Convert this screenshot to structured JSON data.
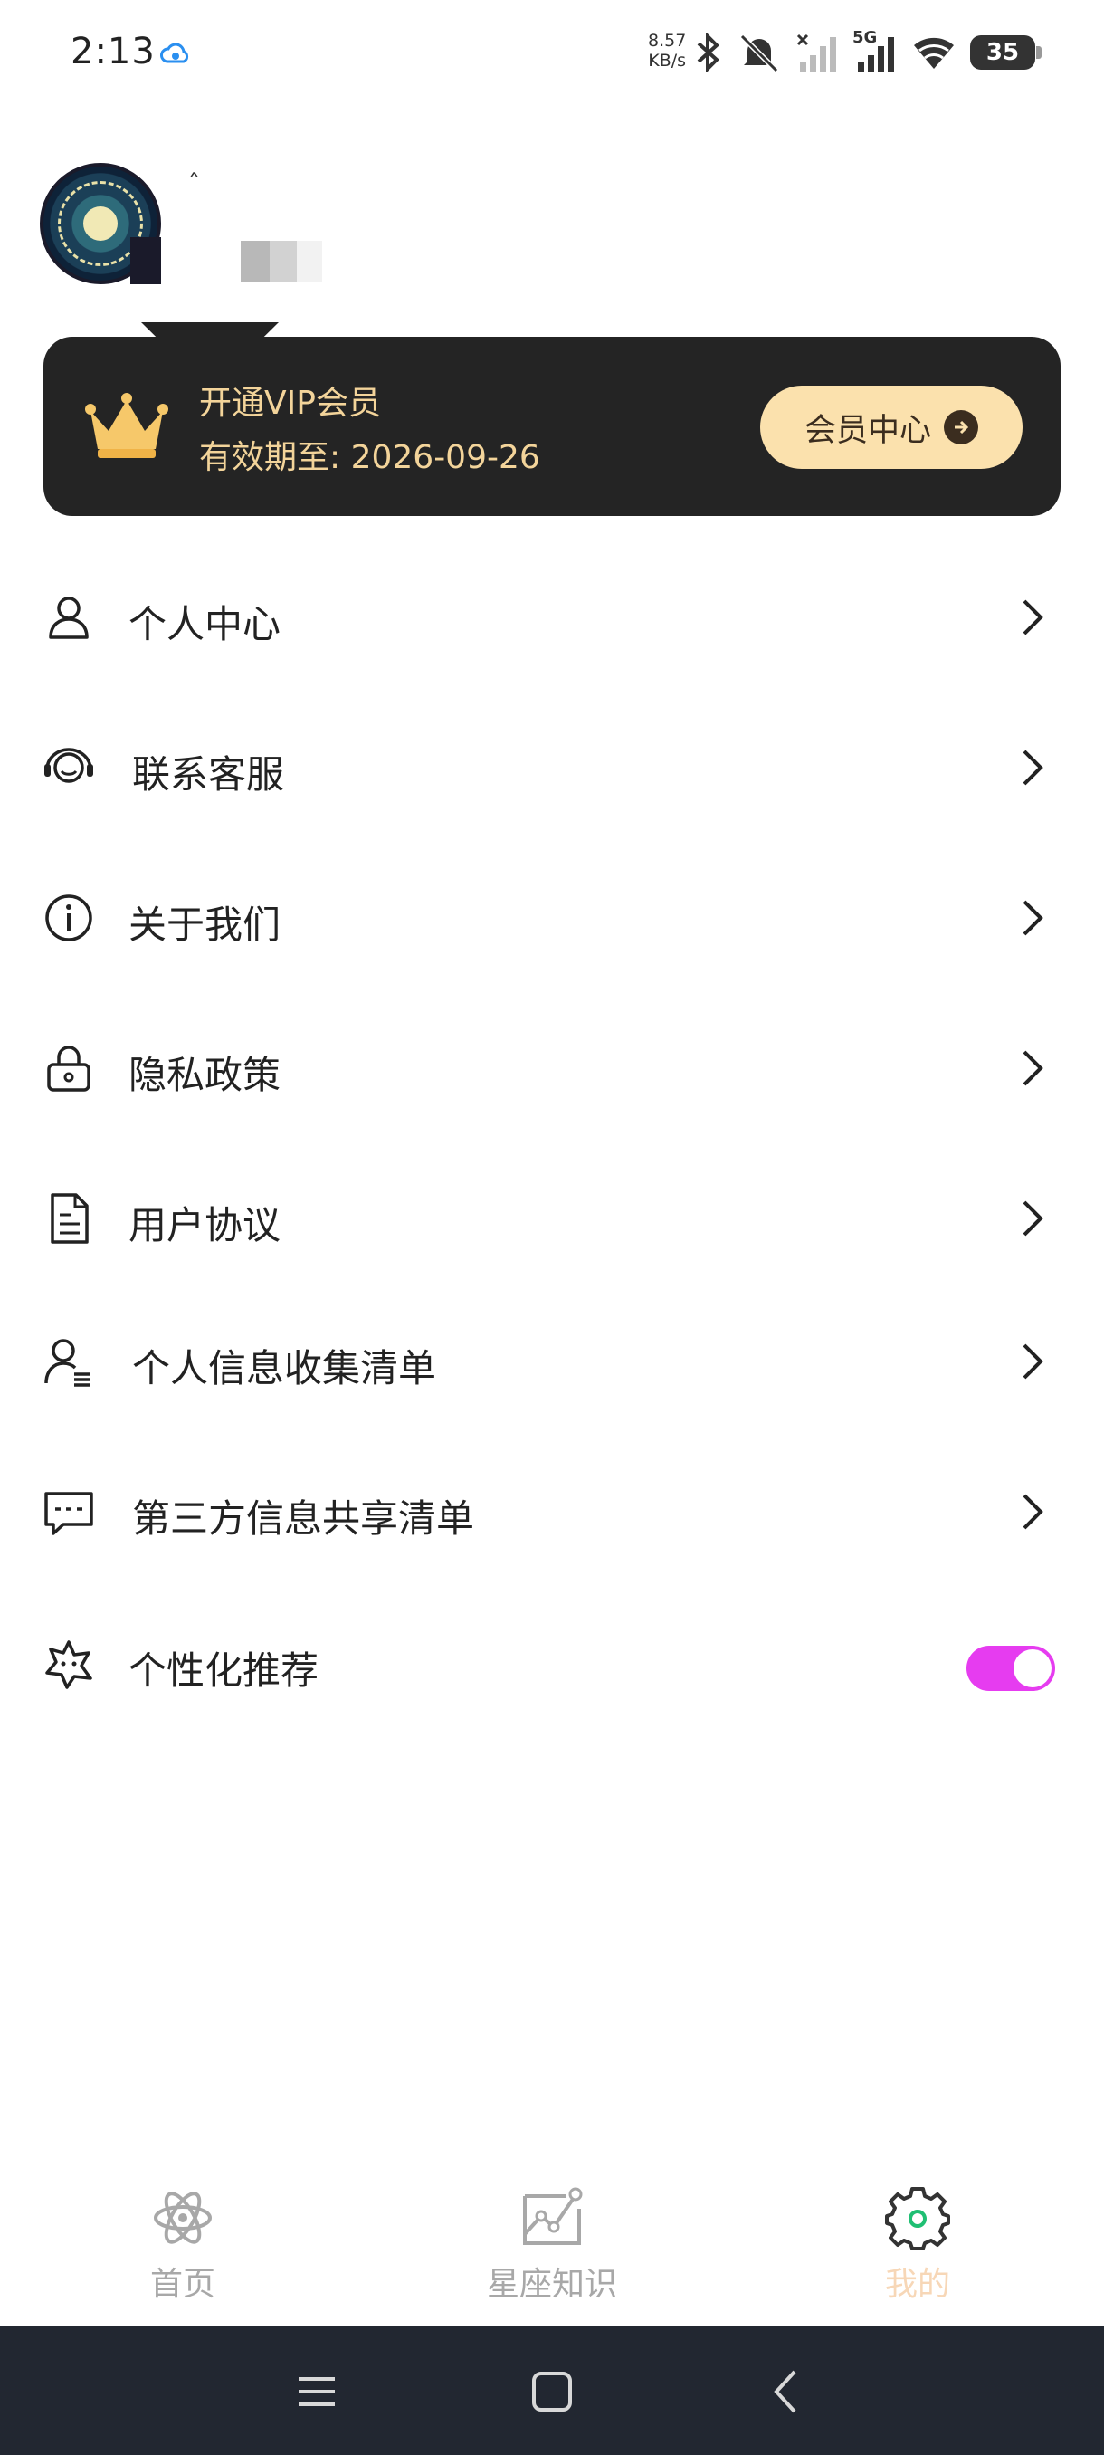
{
  "status_bar": {
    "time": "2:13",
    "net_speed_value": "8.57",
    "net_speed_unit": "KB/s",
    "signal_label": "5G",
    "battery": "35"
  },
  "profile": {
    "username": "ˆ"
  },
  "vip": {
    "title": "开通VIP会员",
    "expiry": "有效期至: 2026-09-26",
    "center_button": "会员中心",
    "accent": "#f3d49a"
  },
  "menu": {
    "items": [
      {
        "label": "个人中心",
        "icon": "user-icon"
      },
      {
        "label": "联系客服",
        "icon": "headset-icon"
      },
      {
        "label": "关于我们",
        "icon": "info-icon"
      },
      {
        "label": "隐私政策",
        "icon": "lock-icon"
      },
      {
        "label": "用户协议",
        "icon": "document-icon"
      },
      {
        "label": "个人信息收集清单",
        "icon": "user-list-icon"
      },
      {
        "label": "第三方信息共享清单",
        "icon": "message-icon"
      },
      {
        "label": "个性化推荐",
        "icon": "star-face-icon",
        "toggle_on": true
      }
    ]
  },
  "bottom_nav": {
    "tabs": [
      {
        "label": "首页",
        "icon": "atom-icon"
      },
      {
        "label": "星座知识",
        "icon": "chart-image-icon"
      },
      {
        "label": "我的",
        "icon": "gear-icon",
        "active": true
      }
    ],
    "active_color": "#f7d7b7",
    "toggle_color": "#e63cf0"
  }
}
